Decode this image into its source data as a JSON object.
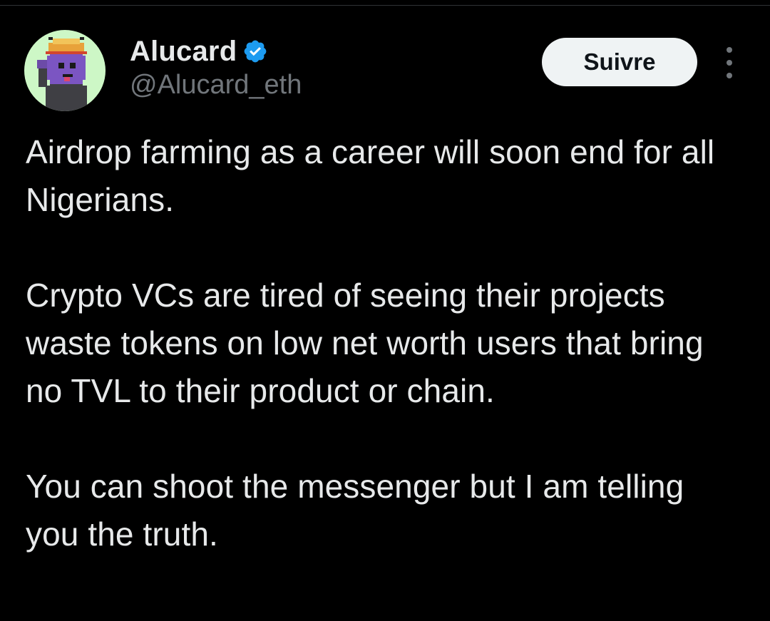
{
  "author": {
    "display_name": "Alucard",
    "handle": "@Alucard_eth",
    "verified": true,
    "avatar_icon": "pixel-character-avatar",
    "verified_icon": "verified-badge-icon"
  },
  "actions": {
    "follow_label": "Suivre",
    "more_icon": "more-options-icon"
  },
  "tweet": {
    "paragraphs": [
      "Airdrop farming as a career will soon end for all Nigerians.",
      "Crypto VCs are tired of seeing their projects waste tokens on low net worth users that bring no TVL to their product or chain.",
      "You can shoot the messenger but I am telling you the truth."
    ]
  },
  "colors": {
    "background": "#000000",
    "text_primary": "#e7e9ea",
    "text_secondary": "#71767b",
    "verified_blue": "#1d9bf0",
    "follow_button_bg": "#eff3f4",
    "follow_button_text": "#0f1419",
    "avatar_bg": "#cdf7c6"
  }
}
